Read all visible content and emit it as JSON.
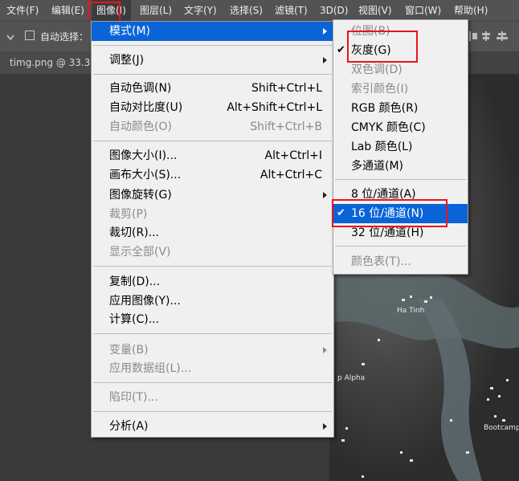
{
  "menubar": {
    "items": [
      "文件(F)",
      "编辑(E)",
      "图像(I)",
      "图层(L)",
      "文字(Y)",
      "选择(S)",
      "滤镜(T)",
      "3D(D)",
      "视图(V)",
      "窗口(W)",
      "帮助(H)"
    ]
  },
  "options_bar": {
    "auto_select_label": "自动选择："
  },
  "document_tab": {
    "title": "timg.png @ 33.3%"
  },
  "image_menu": {
    "items": [
      {
        "label": "模式(M)",
        "shortcut": "",
        "state": "highlighted",
        "submenu": true
      },
      {
        "label": "调整(J)",
        "shortcut": "",
        "state": "normal",
        "submenu": true
      },
      {
        "label": "自动色调(N)",
        "shortcut": "Shift+Ctrl+L",
        "state": "normal"
      },
      {
        "label": "自动对比度(U)",
        "shortcut": "Alt+Shift+Ctrl+L",
        "state": "normal"
      },
      {
        "label": "自动颜色(O)",
        "shortcut": "Shift+Ctrl+B",
        "state": "disabled"
      },
      {
        "label": "图像大小(I)...",
        "shortcut": "Alt+Ctrl+I",
        "state": "normal"
      },
      {
        "label": "画布大小(S)...",
        "shortcut": "Alt+Ctrl+C",
        "state": "normal"
      },
      {
        "label": "图像旋转(G)",
        "shortcut": "",
        "state": "normal",
        "submenu": true
      },
      {
        "label": "裁剪(P)",
        "shortcut": "",
        "state": "disabled"
      },
      {
        "label": "裁切(R)...",
        "shortcut": "",
        "state": "normal"
      },
      {
        "label": "显示全部(V)",
        "shortcut": "",
        "state": "disabled"
      },
      {
        "label": "复制(D)...",
        "shortcut": "",
        "state": "normal"
      },
      {
        "label": "应用图像(Y)...",
        "shortcut": "",
        "state": "normal"
      },
      {
        "label": "计算(C)...",
        "shortcut": "",
        "state": "normal"
      },
      {
        "label": "变量(B)",
        "shortcut": "",
        "state": "disabled",
        "submenu": true
      },
      {
        "label": "应用数据组(L)...",
        "shortcut": "",
        "state": "disabled"
      },
      {
        "label": "陷印(T)...",
        "shortcut": "",
        "state": "disabled"
      },
      {
        "label": "分析(A)",
        "shortcut": "",
        "state": "normal",
        "submenu": true
      }
    ]
  },
  "mode_submenu": {
    "items": [
      {
        "label": "位图(B)",
        "state": "disabled",
        "checked": false
      },
      {
        "label": "灰度(G)",
        "state": "normal",
        "checked": true
      },
      {
        "label": "双色调(D)",
        "state": "disabled",
        "checked": false
      },
      {
        "label": "索引颜色(I)",
        "state": "disabled",
        "checked": false
      },
      {
        "label": "RGB 颜色(R)",
        "state": "normal",
        "checked": false
      },
      {
        "label": "CMYK 颜色(C)",
        "state": "normal",
        "checked": false
      },
      {
        "label": "Lab 颜色(L)",
        "state": "normal",
        "checked": false
      },
      {
        "label": "多通道(M)",
        "state": "normal",
        "checked": false
      },
      {
        "label": "8 位/通道(A)",
        "state": "normal",
        "checked": false
      },
      {
        "label": "16 位/通道(N)",
        "state": "highlighted",
        "checked": true
      },
      {
        "label": "32 位/通道(H)",
        "state": "normal",
        "checked": false
      },
      {
        "label": "颜色表(T)...",
        "state": "disabled",
        "checked": false
      }
    ]
  },
  "map_labels": [
    "Ha Tinh",
    "p Alpha",
    "Bootcamp"
  ],
  "colors": {
    "menu_bg": "#f0f0f0",
    "highlight": "#0a64d8",
    "annotation": "#e8141b",
    "app_bg": "#535353"
  }
}
